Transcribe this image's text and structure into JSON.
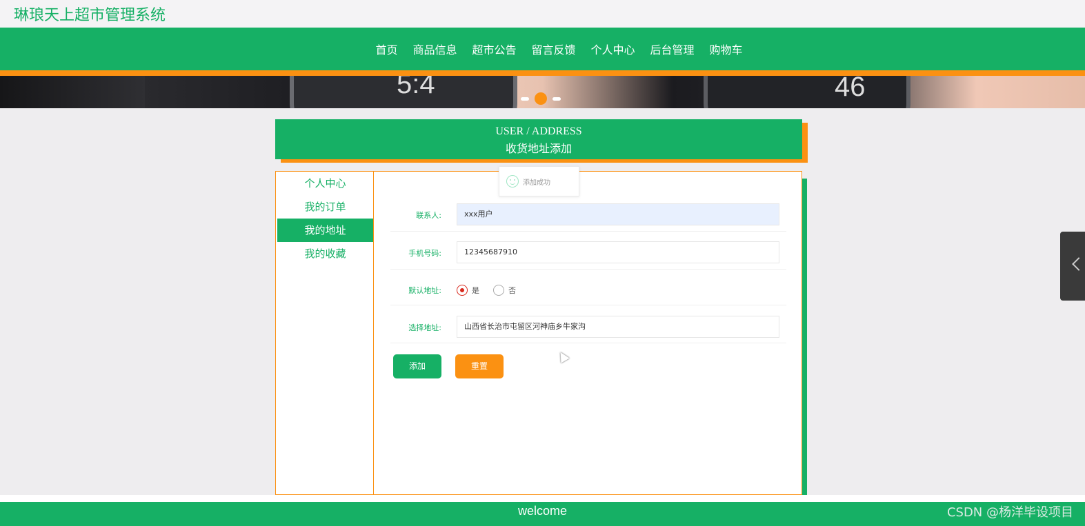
{
  "header": {
    "site_title": "琳琅天上超市管理系统"
  },
  "nav": {
    "items": [
      "首页",
      "商品信息",
      "超市公告",
      "留言反馈",
      "个人中心",
      "后台管理",
      "购物车"
    ]
  },
  "banner": {
    "time_text_1": "5:4",
    "time_text_2": "46",
    "slides_count": 3,
    "active_slide": 2
  },
  "section": {
    "en_title": "USER / ADDRESS",
    "cn_title": "收货地址添加"
  },
  "side_menu": {
    "items": [
      {
        "label": "个人中心",
        "active": false
      },
      {
        "label": "我的订单",
        "active": false
      },
      {
        "label": "我的地址",
        "active": true
      },
      {
        "label": "我的收藏",
        "active": false
      }
    ]
  },
  "toast": {
    "message": "添加成功"
  },
  "form": {
    "contact_label": "联系人:",
    "contact_value": "xxx用户",
    "phone_label": "手机号码:",
    "phone_value": "12345687910",
    "default_label": "默认地址:",
    "default_options": [
      "是",
      "否"
    ],
    "default_selected": "是",
    "address_label": "选择地址:",
    "address_value": "山西省长治市屯留区河神庙乡牛家沟"
  },
  "buttons": {
    "add": "添加",
    "reset": "重置"
  },
  "footer": {
    "text": "welcome"
  },
  "watermark": {
    "text": "CSDN @杨洋毕设项目"
  },
  "colors": {
    "primary": "#16b065",
    "accent": "#fb9112"
  }
}
